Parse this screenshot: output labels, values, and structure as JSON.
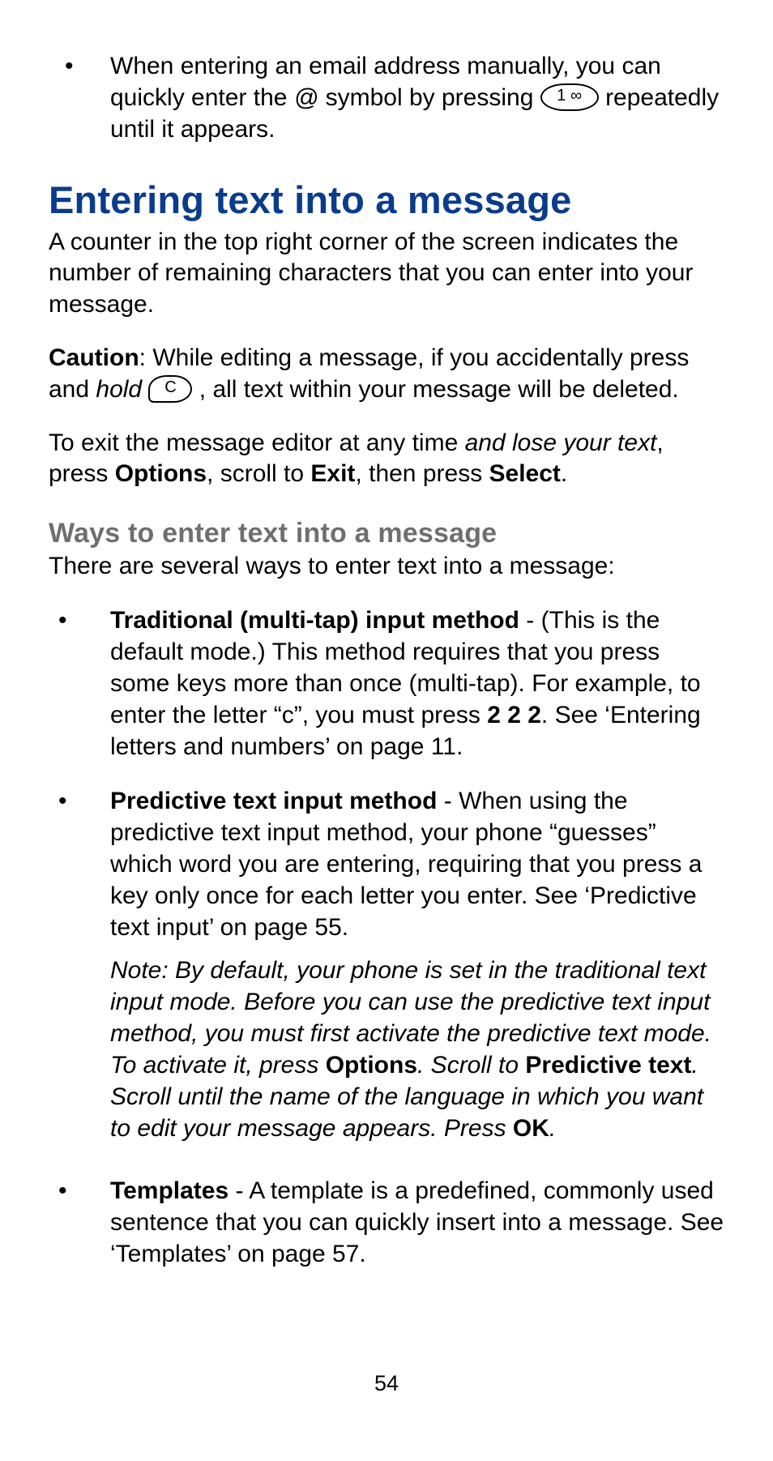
{
  "intro_bullet": {
    "pre": "When entering an email address manually, you can quickly enter the ",
    "at": "@",
    "mid": " symbol by pressing ",
    "key1_label": "1 ∞",
    "post": " repeatedly until it appears."
  },
  "section_heading": "Entering text into a message",
  "para_counter": "A counter in the top right corner of the screen indicates the number of remaining characters that you can enter into your message.",
  "caution": {
    "label": "Caution",
    "pre": ": While editing a message, if you accidentally press and ",
    "hold": "hold",
    "gap": " ",
    "key_c": "C",
    "post": " , all text within your message will be deleted."
  },
  "exit_para": {
    "pre": "To exit the message editor at any time ",
    "italic": "and lose your text",
    "mid1": ", press ",
    "b1": "Options",
    "mid2": ", scroll to ",
    "b2": "Exit",
    "mid3": ", then press ",
    "b3": "Select",
    "end": "."
  },
  "sub_heading": "Ways to enter text into a message",
  "sub_intro": "There are several ways to enter text into a message:",
  "ways": {
    "traditional": {
      "title": "Traditional (multi-tap) input method",
      "dash": " - ",
      "body_a": "(This is the default mode.) This method requires that you press some keys more than once (multi-tap). For example, to enter the letter “c”, you must press ",
      "keys": "2 2 2",
      "body_b": ". See ‘Entering letters and numbers’ on page 11."
    },
    "predictive": {
      "title": "Predictive text input method",
      "dash": " - ",
      "body": "When using the predictive text input method, your phone “guesses” which word you are entering, requiring that you press a key only once for each letter you enter. See ‘Predictive text input’ on page 55.",
      "note": {
        "a": "Note: By default, your phone is set in the traditional text input mode. Before you can use the predictive text input method, you must first activate the predictive text mode. To activate it, press ",
        "b1": "Options",
        "b": ". Scroll to ",
        "b2": "Predictive text",
        "c": ". Scroll until the name of the language in which you want to edit your message appears. Press ",
        "b3": "OK",
        "d": "."
      }
    },
    "templates": {
      "title": "Templates",
      "dash": " - ",
      "body": "A template is a predefined, commonly used sentence that you can quickly insert into a message. See ‘Templates’ on page 57."
    }
  },
  "page_number": "54"
}
